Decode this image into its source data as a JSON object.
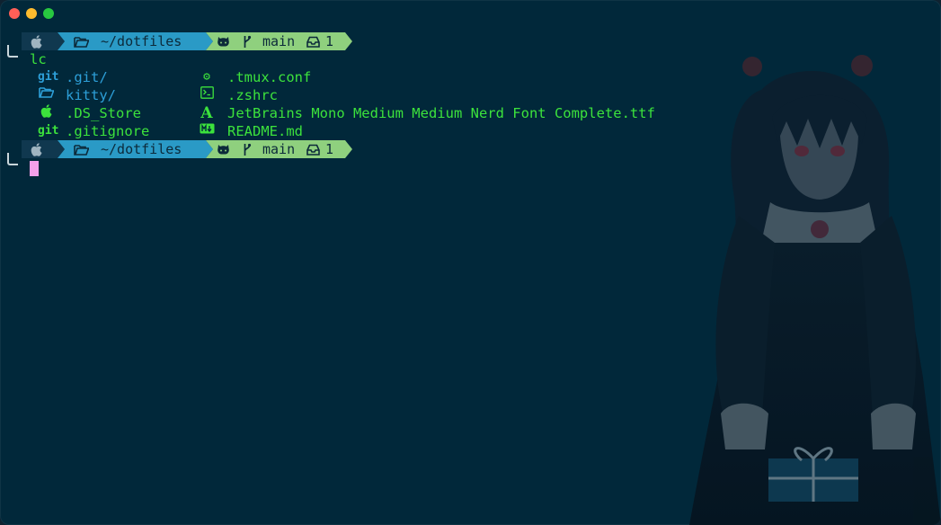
{
  "window": {
    "traffic_lights": [
      "close",
      "minimize",
      "zoom"
    ]
  },
  "prompt": {
    "os_icon": "apple-icon",
    "path": "~/dotfiles",
    "path_icon": "folder-open-icon",
    "vcs_icon": "github-icon",
    "branch_icon": "git-branch-icon",
    "branch": "main",
    "changes_icon": "inbox-icon",
    "changes_count": "1",
    "colors": {
      "os_bg": "#10384f",
      "path_bg": "#2a9ac6",
      "git_bg": "#8fd07e"
    }
  },
  "command": "lc",
  "listing": {
    "col1": [
      {
        "icon": "git-icon",
        "glyph": "git",
        "name": ".git/",
        "color": "#2d9fd8"
      },
      {
        "icon": "folder-icon",
        "glyph": "folder",
        "name": "kitty/",
        "color": "#2d9fd8"
      },
      {
        "icon": "apple-icon",
        "glyph": "apple",
        "name": ".DS_Store",
        "color": "#3ce23c"
      },
      {
        "icon": "git-icon",
        "glyph": "git",
        "name": ".gitignore",
        "color": "#3ce23c"
      }
    ],
    "col2": [
      {
        "icon": "gear-icon",
        "glyph": "⚙",
        "name": ".tmux.conf",
        "color": "#3ce23c"
      },
      {
        "icon": "terminal-icon",
        "glyph": ">_",
        "name": ".zshrc",
        "color": "#3ce23c"
      },
      {
        "icon": "font-icon",
        "glyph": "A",
        "name": "JetBrains Mono Medium Medium Nerd Font Complete.ttf",
        "color": "#3ce23c"
      },
      {
        "icon": "markdown-icon",
        "glyph": "M↓",
        "name": "README.md",
        "color": "#3ce23c"
      }
    ]
  },
  "cursor_color": "#f5a0ea"
}
